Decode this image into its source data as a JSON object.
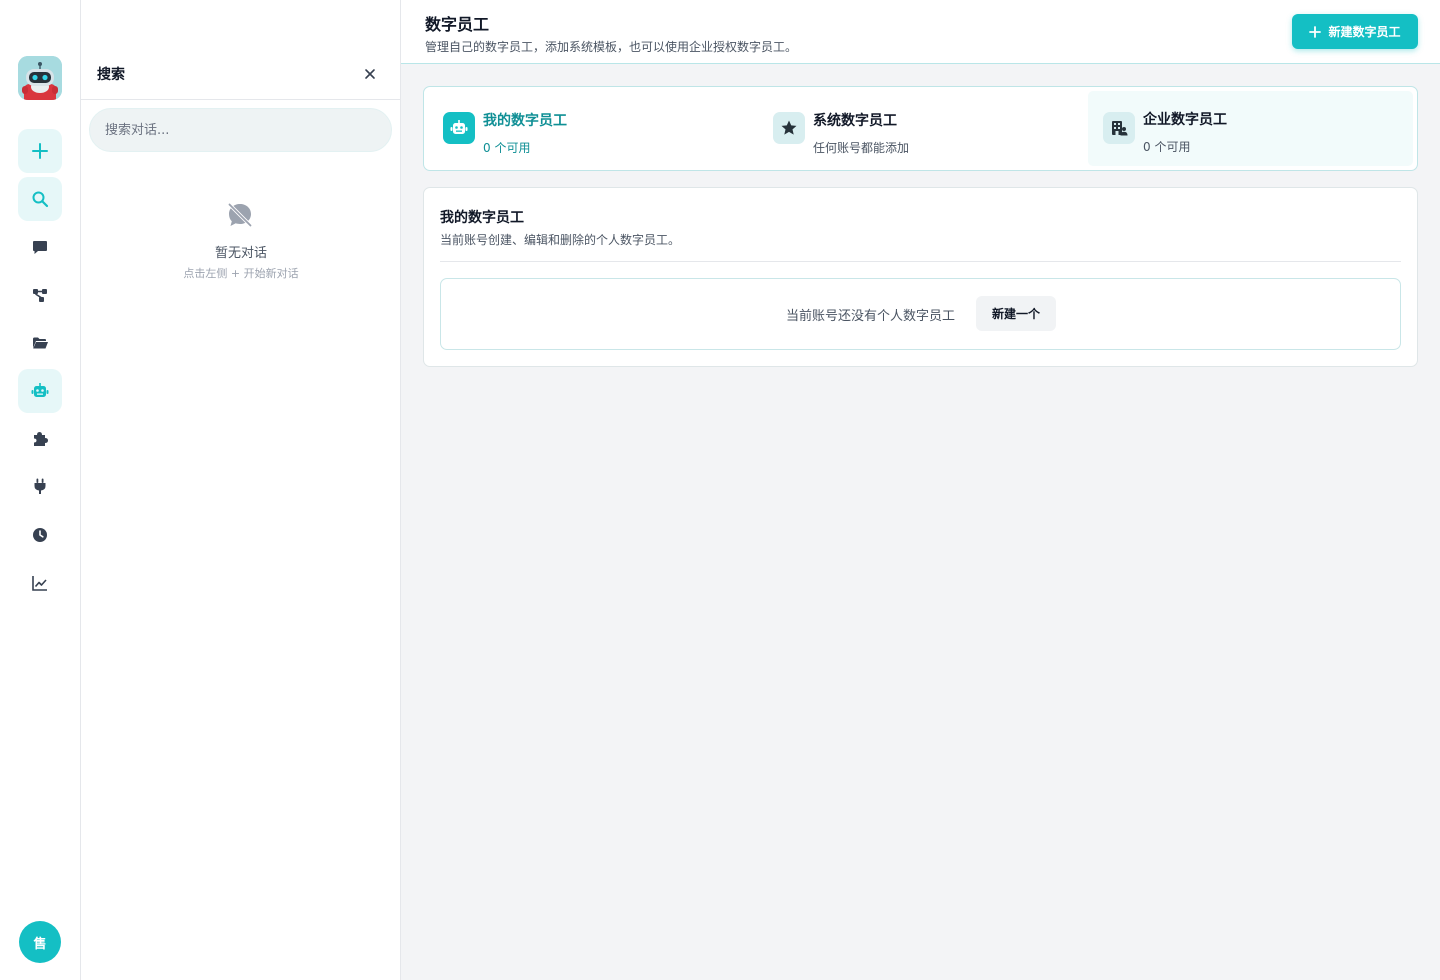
{
  "sidebar": {
    "avatar_text": "售",
    "icons": [
      "new-chat-icon",
      "search-icon",
      "chat-icon",
      "workflow-icon",
      "folder-icon",
      "robot-icon",
      "plugin-icon",
      "plug-icon",
      "history-icon",
      "analytics-icon"
    ]
  },
  "search_panel": {
    "title": "搜索",
    "placeholder": "搜索对话...",
    "empty_title": "暂无对话",
    "empty_hint": "点击左侧 + 开始新对话"
  },
  "header": {
    "title": "数字员工",
    "subtitle": "管理自己的数字员工，添加系统模板，也可以使用企业授权数字员工。",
    "new_button": "新建数字员工"
  },
  "tabs": [
    {
      "label": "我的数字员工",
      "sub": "0 个可用"
    },
    {
      "label": "系统数字员工",
      "sub": "任何账号都能添加"
    },
    {
      "label": "企业数字员工",
      "sub": "0 个可用"
    }
  ],
  "section": {
    "title": "我的数字员工",
    "desc": "当前账号创建、编辑和删除的个人数字员工。",
    "empty_text": "当前账号还没有个人数字员工",
    "create_button": "新建一个"
  },
  "colors": {
    "accent": "#14bfc4",
    "accent_dark": "#0f8f95",
    "accent_light": "#e6f7f8"
  }
}
